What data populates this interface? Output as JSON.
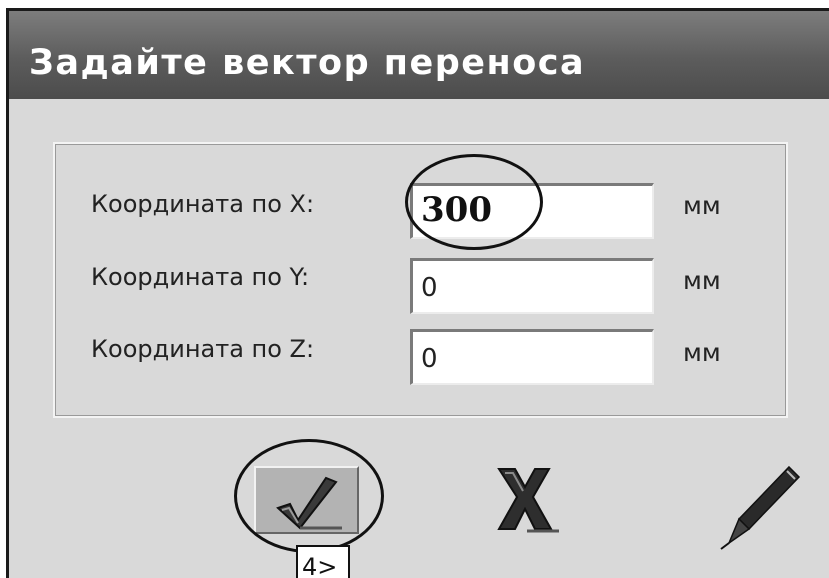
{
  "dialog": {
    "title": "Задайте вектор переноса"
  },
  "fields": [
    {
      "label": "Координата по X:",
      "value": "300",
      "unit": "мм"
    },
    {
      "label": "Координата по Y:",
      "value": "0",
      "unit": "мм"
    },
    {
      "label": "Координата по Z:",
      "value": "0",
      "unit": "мм"
    }
  ],
  "buttons": {
    "ok_icon": "checkmark-icon",
    "cancel_icon": "cross-icon",
    "edit_icon": "pen-icon"
  },
  "tooltip": {
    "text": "4>"
  }
}
